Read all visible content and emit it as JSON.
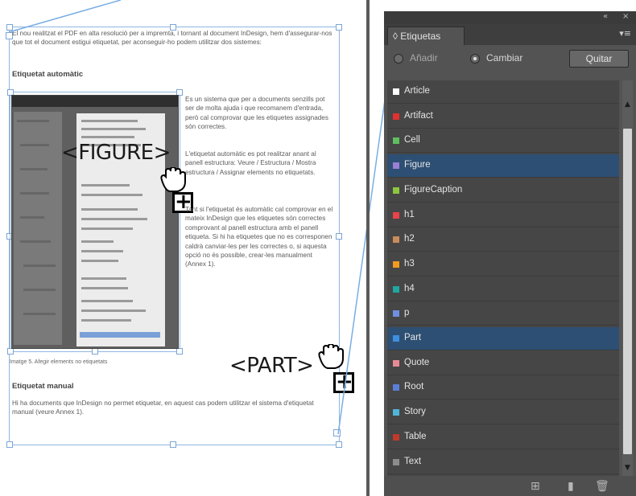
{
  "document": {
    "intro_text": "El nou realitzat el PDF en alta resolució per a impremta, i tornant al document InDesign, hem d'assegurar-nos que tot el document estigui etiquetat, per aconseguir-ho podem utilitzar dos sistemes:",
    "heading_auto": "Etiquetat automàtic",
    "body_text_1": "Es un sistema que per a documents senzills pot ser de molta ajuda i que recomanem d'entrada, però cal comprovar que les etiquetes assignades són correctes.",
    "body_text_2": "L'etiquetat automàtic es pot realitzar anant al panell estructura: Veure / Estructura / Mostra estructura / Assignar elements no etiquetats.",
    "body_text_3": "Tant si l'etiquetat és automàtic cal comprovar en el mateix InDesign que les etiquetes són correctes comprovant al panell estructura amb el panell etiqueta. Si hi ha etiquetes que no es corresponen caldrà canviar-les per les correctes o, si aquesta opció no és possible, crear-les manualment (Annex 1).",
    "figure_caption": "Imatge 5. Afegir elements no etiquetats",
    "heading_manual": "Etiquetat manual",
    "manual_text": "Hi ha documents que InDesign no permet etiquetar, en aquest cas podem utilitzar el sistema d'etiquetat manual (veure Annex 1).",
    "figure_label": "<FIGURE>",
    "part_label": "<PART>",
    "plus_symbol": "+"
  },
  "panel": {
    "collapse_icon": "«",
    "close_icon": "×",
    "tab_title": "◊ Etiquetas",
    "menu_icon": "▾≡",
    "add_label": "Añadir",
    "change_label": "Cambiar",
    "change_selected": true,
    "remove_button": "Quitar",
    "scroll_up": "▲",
    "scroll_down": "▼",
    "bottom_icons": [
      "new-tag-from-selection-icon",
      "new-tag-icon",
      "trash-icon"
    ],
    "tags": [
      {
        "label": "Article",
        "color": "#ffffff",
        "highlighted": false
      },
      {
        "label": "Artifact",
        "color": "#e03131",
        "highlighted": false
      },
      {
        "label": "Cell",
        "color": "#5fbf5f",
        "highlighted": false
      },
      {
        "label": "Figure",
        "color": "#9b7fd4",
        "highlighted": true
      },
      {
        "label": "FigureCaption",
        "color": "#8cc63f",
        "highlighted": false
      },
      {
        "label": "h1",
        "color": "#e8434b",
        "highlighted": false
      },
      {
        "label": "h2",
        "color": "#c98b5b",
        "highlighted": false
      },
      {
        "label": "h3",
        "color": "#f29a1f",
        "highlighted": false
      },
      {
        "label": "h4",
        "color": "#1fa7a0",
        "highlighted": false
      },
      {
        "label": "p",
        "color": "#6f8fe0",
        "highlighted": false
      },
      {
        "label": "Part",
        "color": "#3d8fe0",
        "highlighted": true
      },
      {
        "label": "Quote",
        "color": "#e88a95",
        "highlighted": false
      },
      {
        "label": "Root",
        "color": "#5a7fd6",
        "highlighted": false
      },
      {
        "label": "Story",
        "color": "#4fb6d8",
        "highlighted": false
      },
      {
        "label": "Table",
        "color": "#c0392b",
        "highlighted": false
      },
      {
        "label": "Text",
        "color": "#8c8c8c",
        "highlighted": false
      }
    ]
  }
}
